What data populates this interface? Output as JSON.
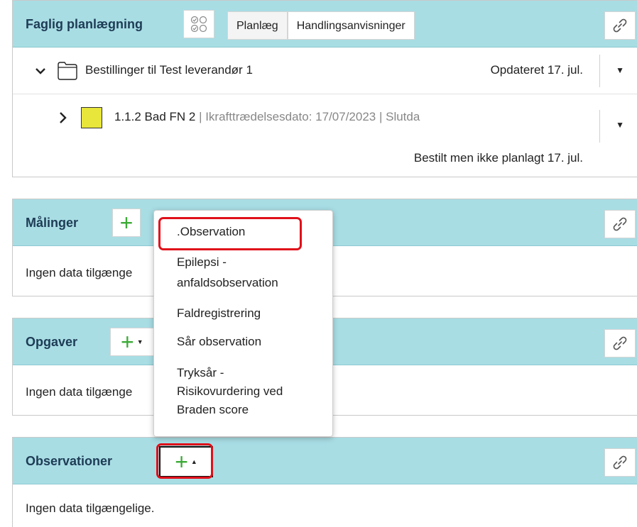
{
  "faglig": {
    "title": "Faglig planlægning",
    "tabs": [
      "Planlæg",
      "Handlingsanvisninger"
    ],
    "group_row": {
      "label": "Bestillinger til Test leverandør 1",
      "status": "Opdateret 17. jul."
    },
    "item_row": {
      "name": "1.1.2 Bad FN 2",
      "details": " | Ikrafttrædelsesdato: 17/07/2023 | Slutda",
      "status": "Bestilt men ikke planlagt 17. jul.",
      "color": "#e8e63a"
    }
  },
  "malinger": {
    "title": "Målinger",
    "empty": "Ingen data tilgænge"
  },
  "opgaver": {
    "title": "Opgaver",
    "empty": "Ingen data tilgænge"
  },
  "observationer": {
    "title": "Observationer",
    "empty": "Ingen data tilgængelige."
  },
  "dropdown": {
    "items": [
      {
        "lines": [
          ".Observation"
        ]
      },
      {
        "lines": [
          "Epilepsi -",
          "anfaldsobservation"
        ]
      },
      {
        "lines": [
          "Faldregistrering"
        ]
      },
      {
        "lines": [
          "Sår observation"
        ]
      },
      {
        "lines": [
          "Tryksår -",
          "Risikovurdering ved",
          "Braden score"
        ]
      }
    ]
  },
  "icons": {
    "link": "link-icon",
    "checklist": "checklist-icon",
    "folder": "folder-icon",
    "plus": "plus-icon",
    "chevron_down": "chevron-down-icon",
    "chevron_right": "chevron-right-icon",
    "caret_down": "caret-down-icon",
    "caret_up": "caret-up-icon"
  },
  "colors": {
    "header_bg": "#a8dde4",
    "title_text": "#1e3c55",
    "plus_green": "#3aaa35",
    "highlight_red": "#e0101a"
  }
}
